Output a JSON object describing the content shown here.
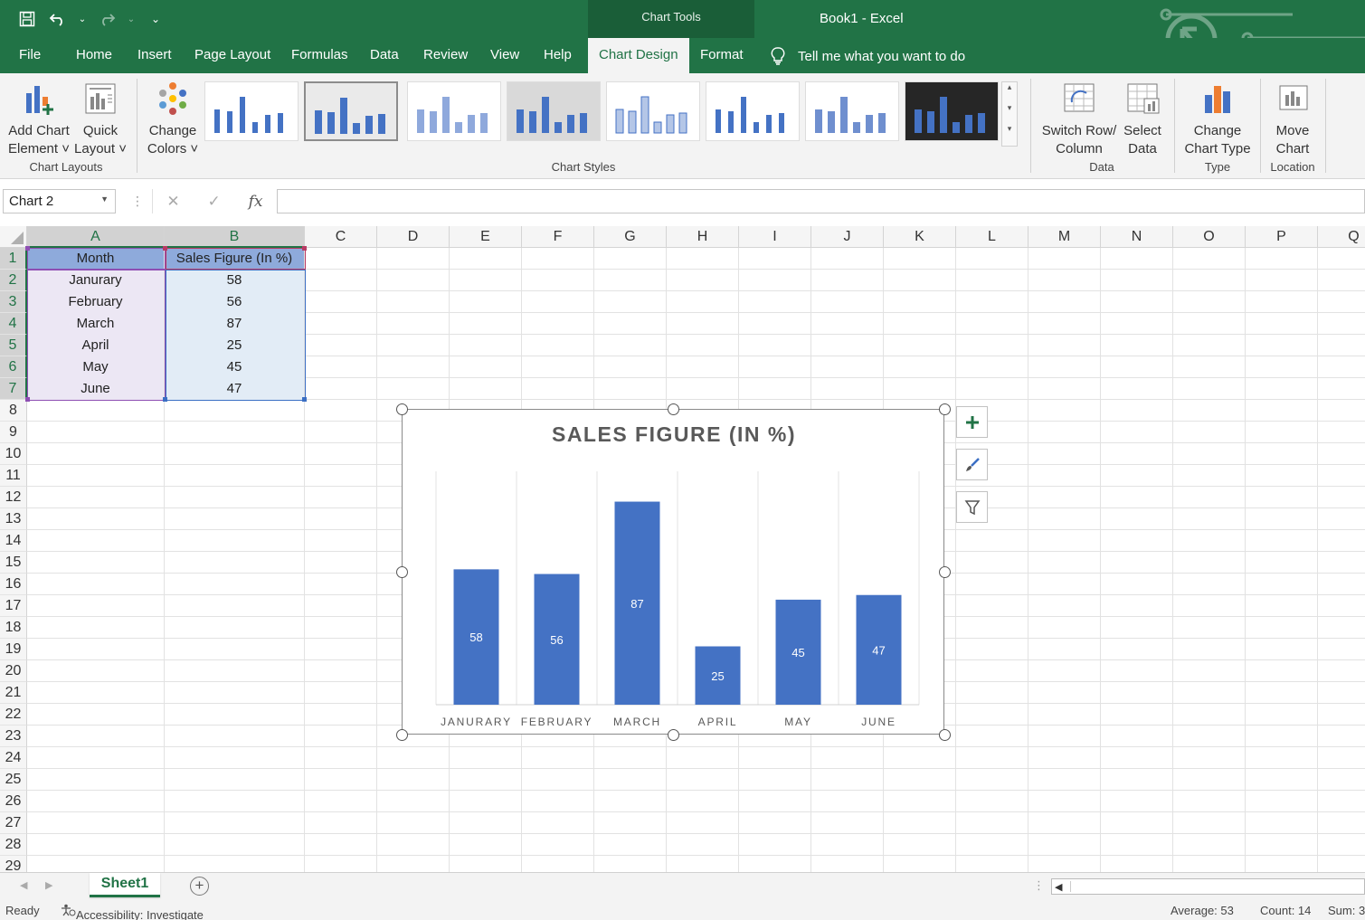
{
  "app": {
    "title": "Book1  -  Excel",
    "contextual_group": "Chart Tools"
  },
  "colors": {
    "brand": "#217346",
    "bar": "#4472c4",
    "header_fill": "#8eaadb"
  },
  "quick_access": [
    "save-icon",
    "undo-icon",
    "redo-icon",
    "customize-icon"
  ],
  "tabs": [
    {
      "label": "File"
    },
    {
      "label": "Home"
    },
    {
      "label": "Insert"
    },
    {
      "label": "Page Layout"
    },
    {
      "label": "Formulas"
    },
    {
      "label": "Data"
    },
    {
      "label": "Review"
    },
    {
      "label": "View"
    },
    {
      "label": "Help"
    },
    {
      "label": "Chart Design",
      "active": true
    },
    {
      "label": "Format"
    }
  ],
  "tell_me": "Tell me what you want to do",
  "ribbon": {
    "add_chart_element": [
      "Add Chart",
      "Element ˅"
    ],
    "quick_layout": [
      "Quick",
      "Layout ˅"
    ],
    "chart_layouts_label": "Chart Layouts",
    "change_colors": [
      "Change",
      "Colors ˅"
    ],
    "chart_styles_label": "Chart Styles",
    "switch_row_column": [
      "Switch Row/",
      "Column"
    ],
    "select_data": [
      "Select",
      "Data"
    ],
    "data_label": "Data",
    "change_chart_type": [
      "Change",
      "Chart Type"
    ],
    "type_label": "Type",
    "move_chart": [
      "Move",
      "Chart"
    ],
    "location_label": "Location"
  },
  "formula_bar": {
    "name_box": "Chart 2",
    "fx": "fx",
    "formula": ""
  },
  "columns": [
    "A",
    "B",
    "C",
    "D",
    "E",
    "F",
    "G",
    "H",
    "I",
    "J",
    "K",
    "L",
    "M",
    "N",
    "O",
    "P",
    "Q"
  ],
  "rows": [
    "1",
    "2",
    "3",
    "4",
    "5",
    "6",
    "7",
    "8",
    "9",
    "10",
    "11",
    "12",
    "13",
    "14",
    "15",
    "16",
    "17",
    "18",
    "19",
    "20",
    "21",
    "22",
    "23",
    "24",
    "25",
    "26",
    "27",
    "28",
    "29"
  ],
  "table": {
    "headers": [
      "Month",
      "Sales Figure (In %)"
    ],
    "rows": [
      [
        "Janurary",
        "58"
      ],
      [
        "February",
        "56"
      ],
      [
        "March",
        "87"
      ],
      [
        "April",
        "25"
      ],
      [
        "May",
        "45"
      ],
      [
        "June",
        "47"
      ]
    ]
  },
  "chart_data": {
    "type": "bar",
    "title": "SALES FIGURE (IN %)",
    "categories": [
      "JANURARY",
      "FEBRUARY",
      "MARCH",
      "APRIL",
      "MAY",
      "JUNE"
    ],
    "values": [
      58,
      56,
      87,
      25,
      45,
      47
    ],
    "data_labels": true,
    "xlabel": "",
    "ylabel": "",
    "ylim": [
      0,
      100
    ],
    "grid": "vertical",
    "legend": "none"
  },
  "sheet": {
    "tab": "Sheet1"
  },
  "status": {
    "ready": "Ready",
    "accessibility": "Accessibility: Investigate",
    "average": "Average: 53",
    "count": "Count: 14",
    "sum": "Sum: 3"
  }
}
